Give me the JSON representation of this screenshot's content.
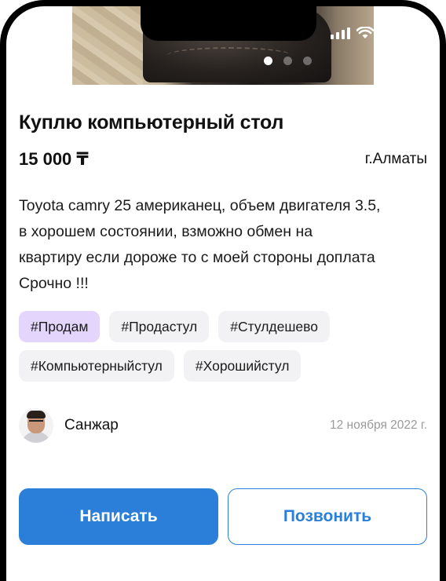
{
  "listing": {
    "title": "Куплю компьютерный стол",
    "price": "15 000 ₸",
    "city": "г.Алматы",
    "description": "Toyota camry 25 американец, объем двигателя 3.5,\nв хорошем состоянии, взможно обмен на\nквартиру если дороже то с моей стороны доплата\nСрочно !!!",
    "photo": {
      "slides": 3,
      "active_index": 0
    }
  },
  "tags": [
    {
      "label": "#Продам",
      "active": true
    },
    {
      "label": "#Продастул",
      "active": false
    },
    {
      "label": "#Стулдешево",
      "active": false
    },
    {
      "label": "#Компьютерныйстул",
      "active": false
    },
    {
      "label": "#Хорошийстул",
      "active": false
    }
  ],
  "author": {
    "name": "Санжар",
    "date": "12 ноября 2022 г."
  },
  "actions": {
    "write_label": "Написать",
    "call_label": "Позвонить"
  },
  "colors": {
    "primary": "#2b7fd8",
    "tag_active": "#e3d5fb",
    "tag_default": "#f2f2f4",
    "muted_text": "#9a9a9a"
  },
  "icons": {
    "status": [
      "signal-icon",
      "wifi-icon"
    ]
  }
}
